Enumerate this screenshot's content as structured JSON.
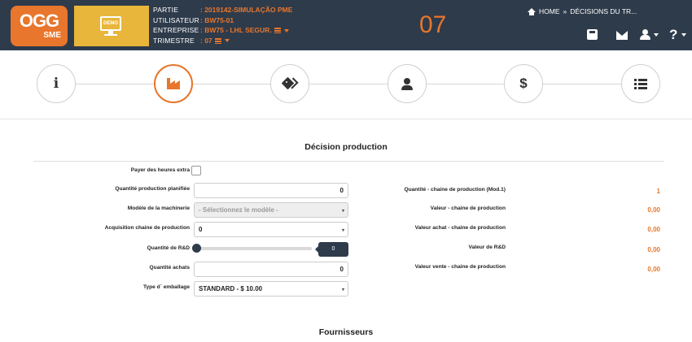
{
  "brand": {
    "logo_main": "OGG",
    "logo_sub": "SME",
    "demo_label": "DEMO",
    "accent": "#e8762c",
    "header_bg": "#2e3b4b"
  },
  "header": {
    "partie_label": "PARTIE",
    "partie_value": ": 2019142-SIMULAÇÃO PME",
    "utilisateur_label": "UTILISATEUR",
    "utilisateur_value": ": BW75-01",
    "entreprise_label": "ENTREPRISE",
    "entreprise_value": ": BW75 - LHL SEGUR.",
    "trimestre_label": "TRIMESTRE",
    "trimestre_value": ": 07",
    "quarter_big": "07",
    "breadcrumb_home": "HOME",
    "breadcrumb_sep": "»",
    "breadcrumb_current": "DÉCISIONS DU TR...",
    "icons": [
      "save-icon",
      "mail-icon",
      "user-icon",
      "help-icon"
    ]
  },
  "steps": [
    {
      "name": "info",
      "icon": "info-icon",
      "active": false
    },
    {
      "name": "production",
      "icon": "factory-icon",
      "active": true
    },
    {
      "name": "marketing",
      "icon": "tags-icon",
      "active": false
    },
    {
      "name": "personnel",
      "icon": "person-icon",
      "active": false
    },
    {
      "name": "finance",
      "icon": "dollar-icon",
      "active": false
    },
    {
      "name": "summary",
      "icon": "list-icon",
      "active": false
    }
  ],
  "production": {
    "title": "Décision production",
    "payer_label": "Payer des heures extra",
    "payer_checked": false,
    "quantite_label": "Quantité production planifiée",
    "quantite_value": "0",
    "modele_label": "Modèle de la machinerie",
    "modele_placeholder": "- Sélectionnez le modèle -",
    "acquisition_label": "Acquisition chaine de production",
    "acquisition_value": "0",
    "rd_label": "Quantité de R&D",
    "rd_value": "0",
    "rd_level": 0,
    "achats_label": "Quantité achats",
    "achats_value": "0",
    "emballage_label": "Type d` emballage",
    "emballage_value": "STANDARD - $ 10.00",
    "right": [
      {
        "label": "Quantité - chaine de production (Mod.1)",
        "value": "1"
      },
      {
        "label": "Valeur - chaine de production",
        "value": "0,00"
      },
      {
        "label": "Valeur achat - chaine de production",
        "value": "0,00"
      },
      {
        "label": "Valeur de R&D",
        "value": "0,00"
      },
      {
        "label": "Valeur vente - chaine de production",
        "value": "0,00"
      }
    ]
  },
  "fournisseurs": {
    "title": "Fournisseurs"
  }
}
